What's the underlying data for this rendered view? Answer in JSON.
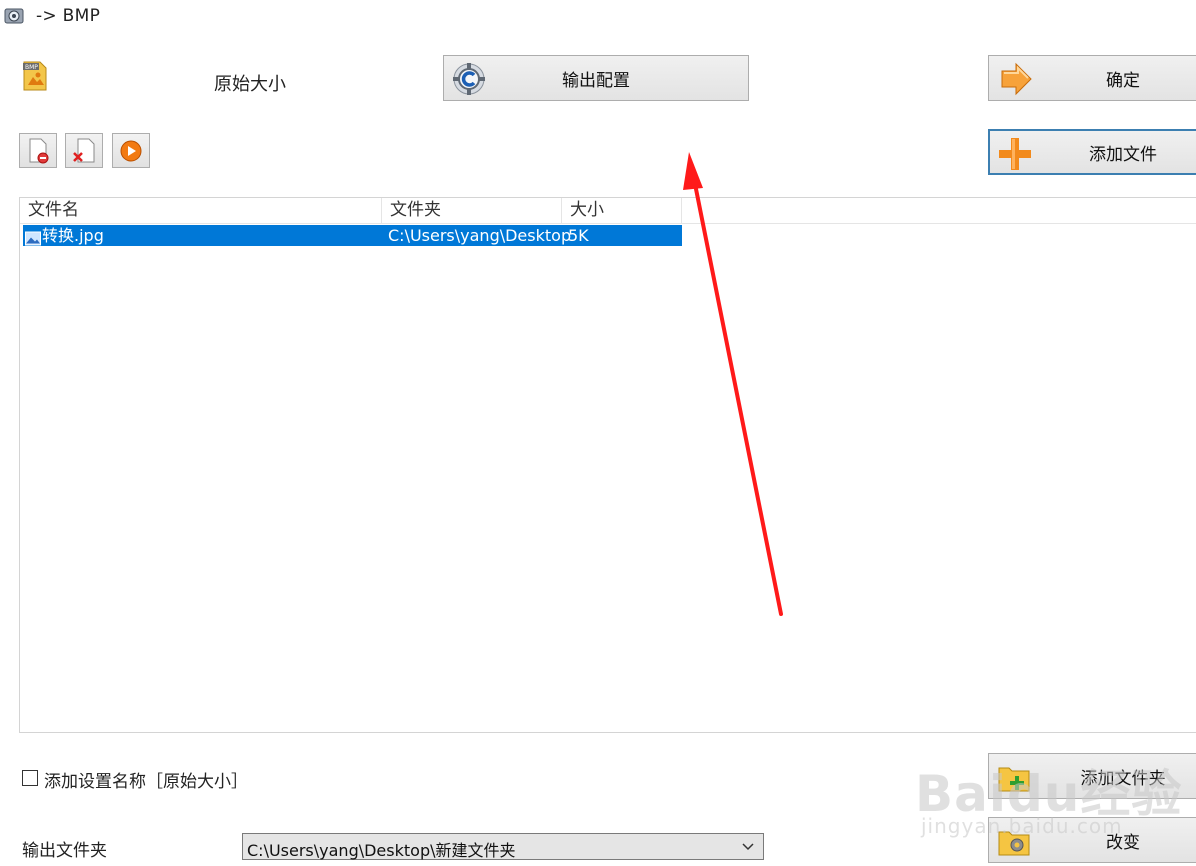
{
  "window": {
    "title": "-> BMP"
  },
  "format": {
    "preset_label": "原始大小",
    "icon": "bmp-file-icon"
  },
  "buttons": {
    "output_config": "输出配置",
    "ok": "确定",
    "add_file": "添加文件",
    "add_folder": "添加文件夹",
    "change": "改变"
  },
  "toolbar": {
    "icons": [
      "remove-file-icon",
      "clear-list-icon",
      "play-icon"
    ]
  },
  "file_list": {
    "columns": [
      "文件名",
      "文件夹",
      "大小"
    ],
    "rows": [
      {
        "name": "转换.jpg",
        "folder": "C:\\Users\\yang\\Desktop",
        "size": "5K",
        "selected": true
      }
    ]
  },
  "options": {
    "add_setting_name_label": "添加设置名称［原始大小］",
    "add_setting_name_checked": false
  },
  "output": {
    "label": "输出文件夹",
    "folder": "C:\\Users\\yang\\Desktop\\新建文件夹"
  },
  "watermark": {
    "brand": "Baidu经验",
    "url": "jingyan.baidu.com"
  },
  "colors": {
    "selection": "#0078d7",
    "annotation_arrow": "#ff1a1a",
    "focus_border": "#3c7fb1"
  }
}
